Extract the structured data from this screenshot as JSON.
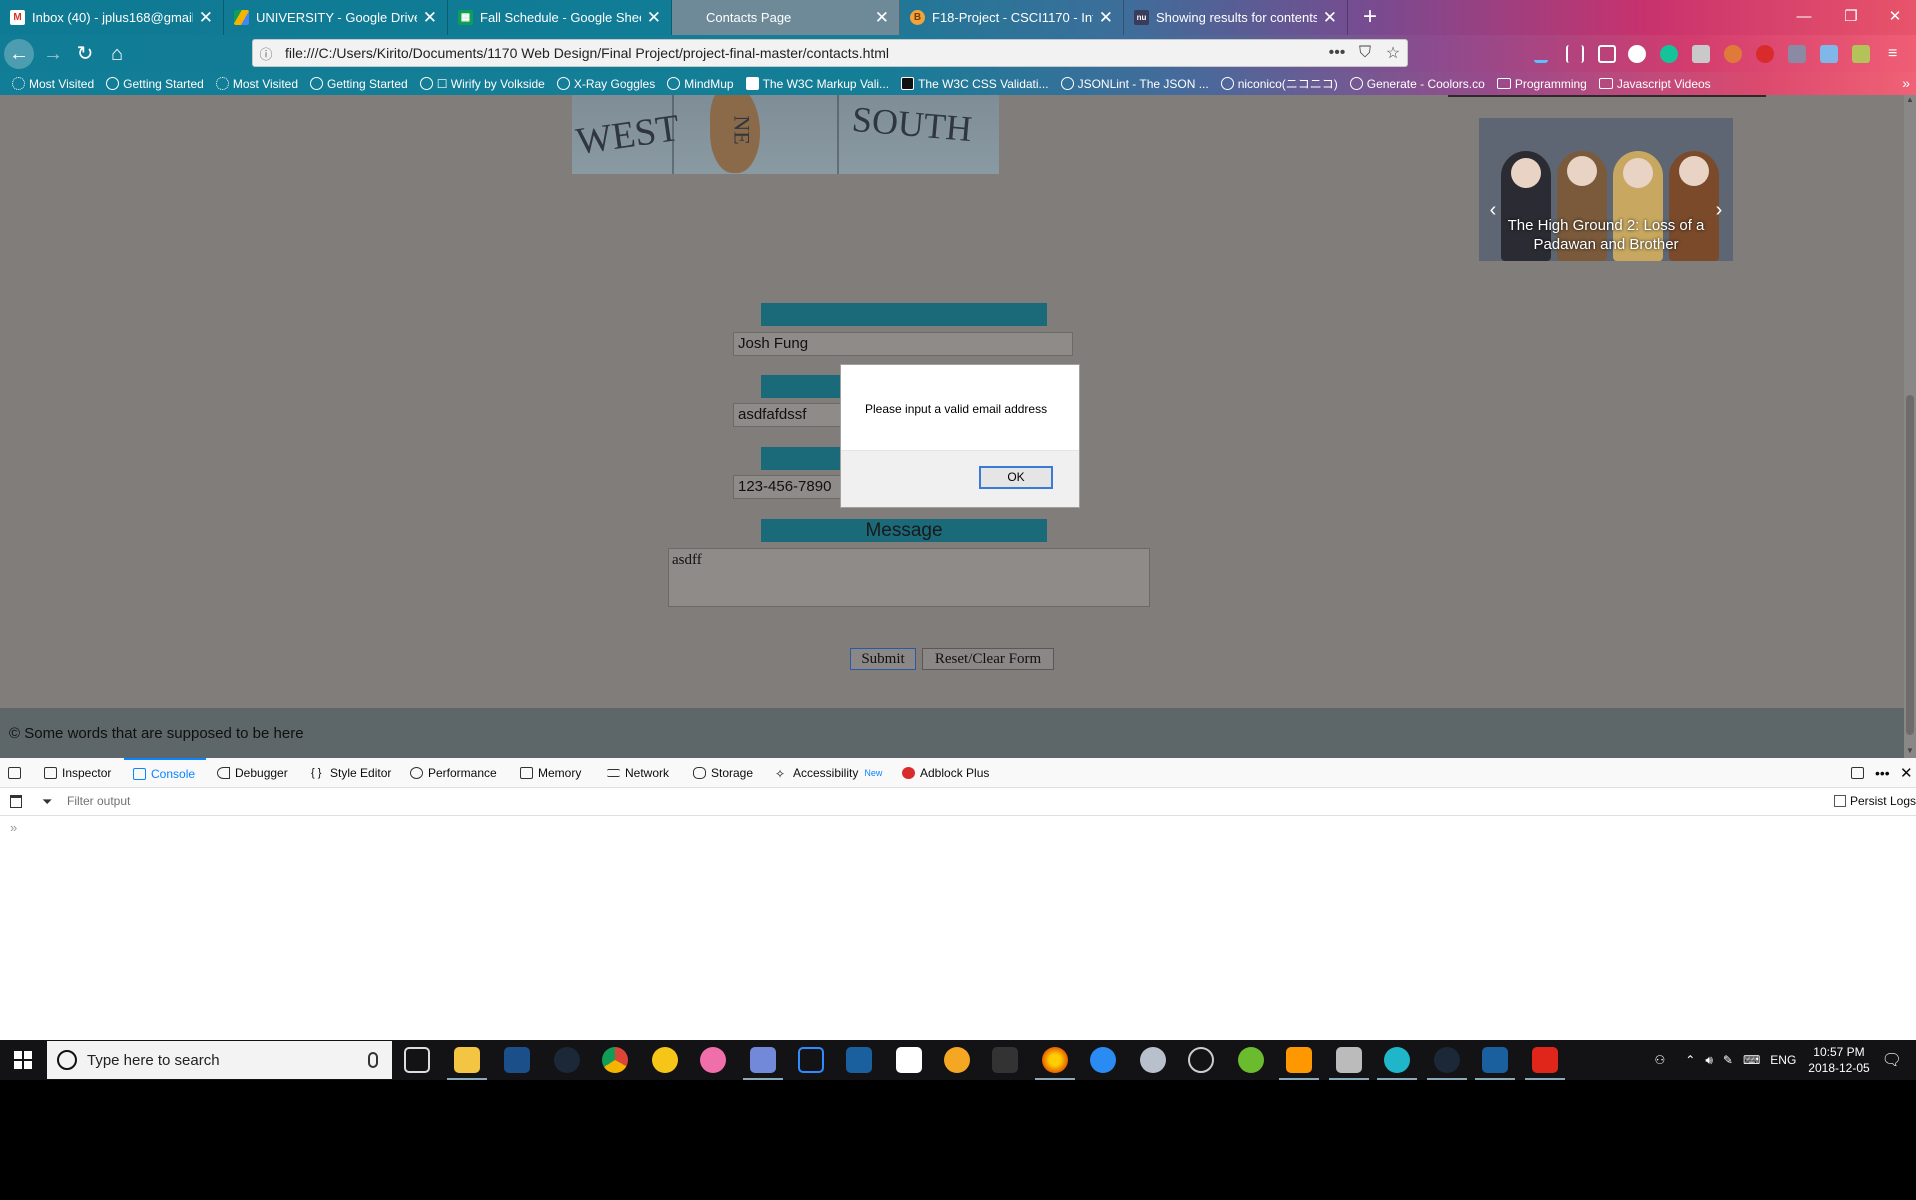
{
  "browser": {
    "tabs": [
      {
        "title": "Inbox (40) - jplus168@gmail.co",
        "icon": "gmail-icon",
        "icon_color": "#d93025"
      },
      {
        "title": "UNIVERSITY - Google Drive",
        "icon": "google-drive-icon",
        "icon_color": "#f4b400"
      },
      {
        "title": "Fall Schedule - Google Sheets",
        "icon": "google-sheets-icon",
        "icon_color": "#0f9d58"
      },
      {
        "title": "Contacts Page",
        "icon": "",
        "icon_color": ""
      },
      {
        "title": "F18-Project - CSCI1170 - Intro t",
        "icon": "bitbucket-icon",
        "icon_color": "#f2a33a"
      },
      {
        "title": "Showing results for contents o",
        "icon": "nu-icon",
        "icon_color": "#3b3b5c"
      }
    ],
    "new_tab_label": "+",
    "window_controls": {
      "minimize": "—",
      "restore": "❐",
      "close": "✕"
    },
    "address": "file:///C:/Users/Kirito/Documents/1170 Web Design/Final Project/project-final-master/contacts.html",
    "page_actions": {
      "more": "•••",
      "pocket": "⛉",
      "bookmark": "☆"
    },
    "bookmarks": [
      {
        "label": "Most Visited",
        "icon": "gear-icon"
      },
      {
        "label": "Getting Started",
        "icon": "globe-icon"
      },
      {
        "label": "Most Visited",
        "icon": "gear-icon"
      },
      {
        "label": "Getting Started",
        "icon": "globe-icon"
      },
      {
        "label": "☐ Wirify by Volkside",
        "icon": "globe-icon"
      },
      {
        "label": "X-Ray Goggles",
        "icon": "globe-icon"
      },
      {
        "label": "MindMup",
        "icon": "globe-icon"
      },
      {
        "label": "The W3C Markup Vali...",
        "icon": "w3c-icon"
      },
      {
        "label": "The W3C CSS Validati...",
        "icon": "w3c-css-icon"
      },
      {
        "label": "JSONLint - The JSON ...",
        "icon": "globe-icon"
      },
      {
        "label": "niconico(ニコニコ)",
        "icon": "globe-icon"
      },
      {
        "label": "Generate - Coolors.co",
        "icon": "globe-icon"
      },
      {
        "label": "Programming",
        "icon": "folder-icon"
      },
      {
        "label": "Javascript Videos",
        "icon": "folder-icon"
      }
    ],
    "bookmarks_overflow": "»"
  },
  "page": {
    "map_words": {
      "west": "WEST",
      "south": "SOUTH",
      "ne": "NE"
    },
    "carousel": {
      "caption": "The High Ground 2: Loss of a Padawan and Brother",
      "prev": "‹",
      "next": "›"
    },
    "form": {
      "name_value": "Josh Fung",
      "email_value": "asdfafdssf",
      "phone_label": "Phone Number",
      "phone_value": "123-456-7890",
      "message_label": "Message",
      "message_value": "asdff",
      "submit_label": "Submit",
      "reset_label": "Reset/Clear Form"
    },
    "footer_text": "© Some words that are supposed to be here"
  },
  "dialog": {
    "message": "Please input a valid email address",
    "ok_label": "OK"
  },
  "devtools": {
    "tabs": [
      {
        "label": "Inspector",
        "icon": "inspector-icon"
      },
      {
        "label": "Console",
        "icon": "console-icon",
        "active": true
      },
      {
        "label": "Debugger",
        "icon": "debugger-icon"
      },
      {
        "label": "Style Editor",
        "icon": "style-editor-icon"
      },
      {
        "label": "Performance",
        "icon": "performance-icon"
      },
      {
        "label": "Memory",
        "icon": "memory-icon"
      },
      {
        "label": "Network",
        "icon": "network-icon"
      },
      {
        "label": "Storage",
        "icon": "storage-icon"
      },
      {
        "label": "Accessibility",
        "icon": "accessibility-icon",
        "badge": "New"
      },
      {
        "label": "Adblock Plus",
        "icon": "abp-icon"
      }
    ],
    "filter_placeholder": "Filter output",
    "persist_logs_label": "Persist Logs",
    "prompt": "»",
    "accent": "#0a84ff"
  },
  "taskbar": {
    "search_placeholder": "Type here to search",
    "language": "ENG",
    "time": "10:57 PM",
    "date": "2018-12-05"
  }
}
